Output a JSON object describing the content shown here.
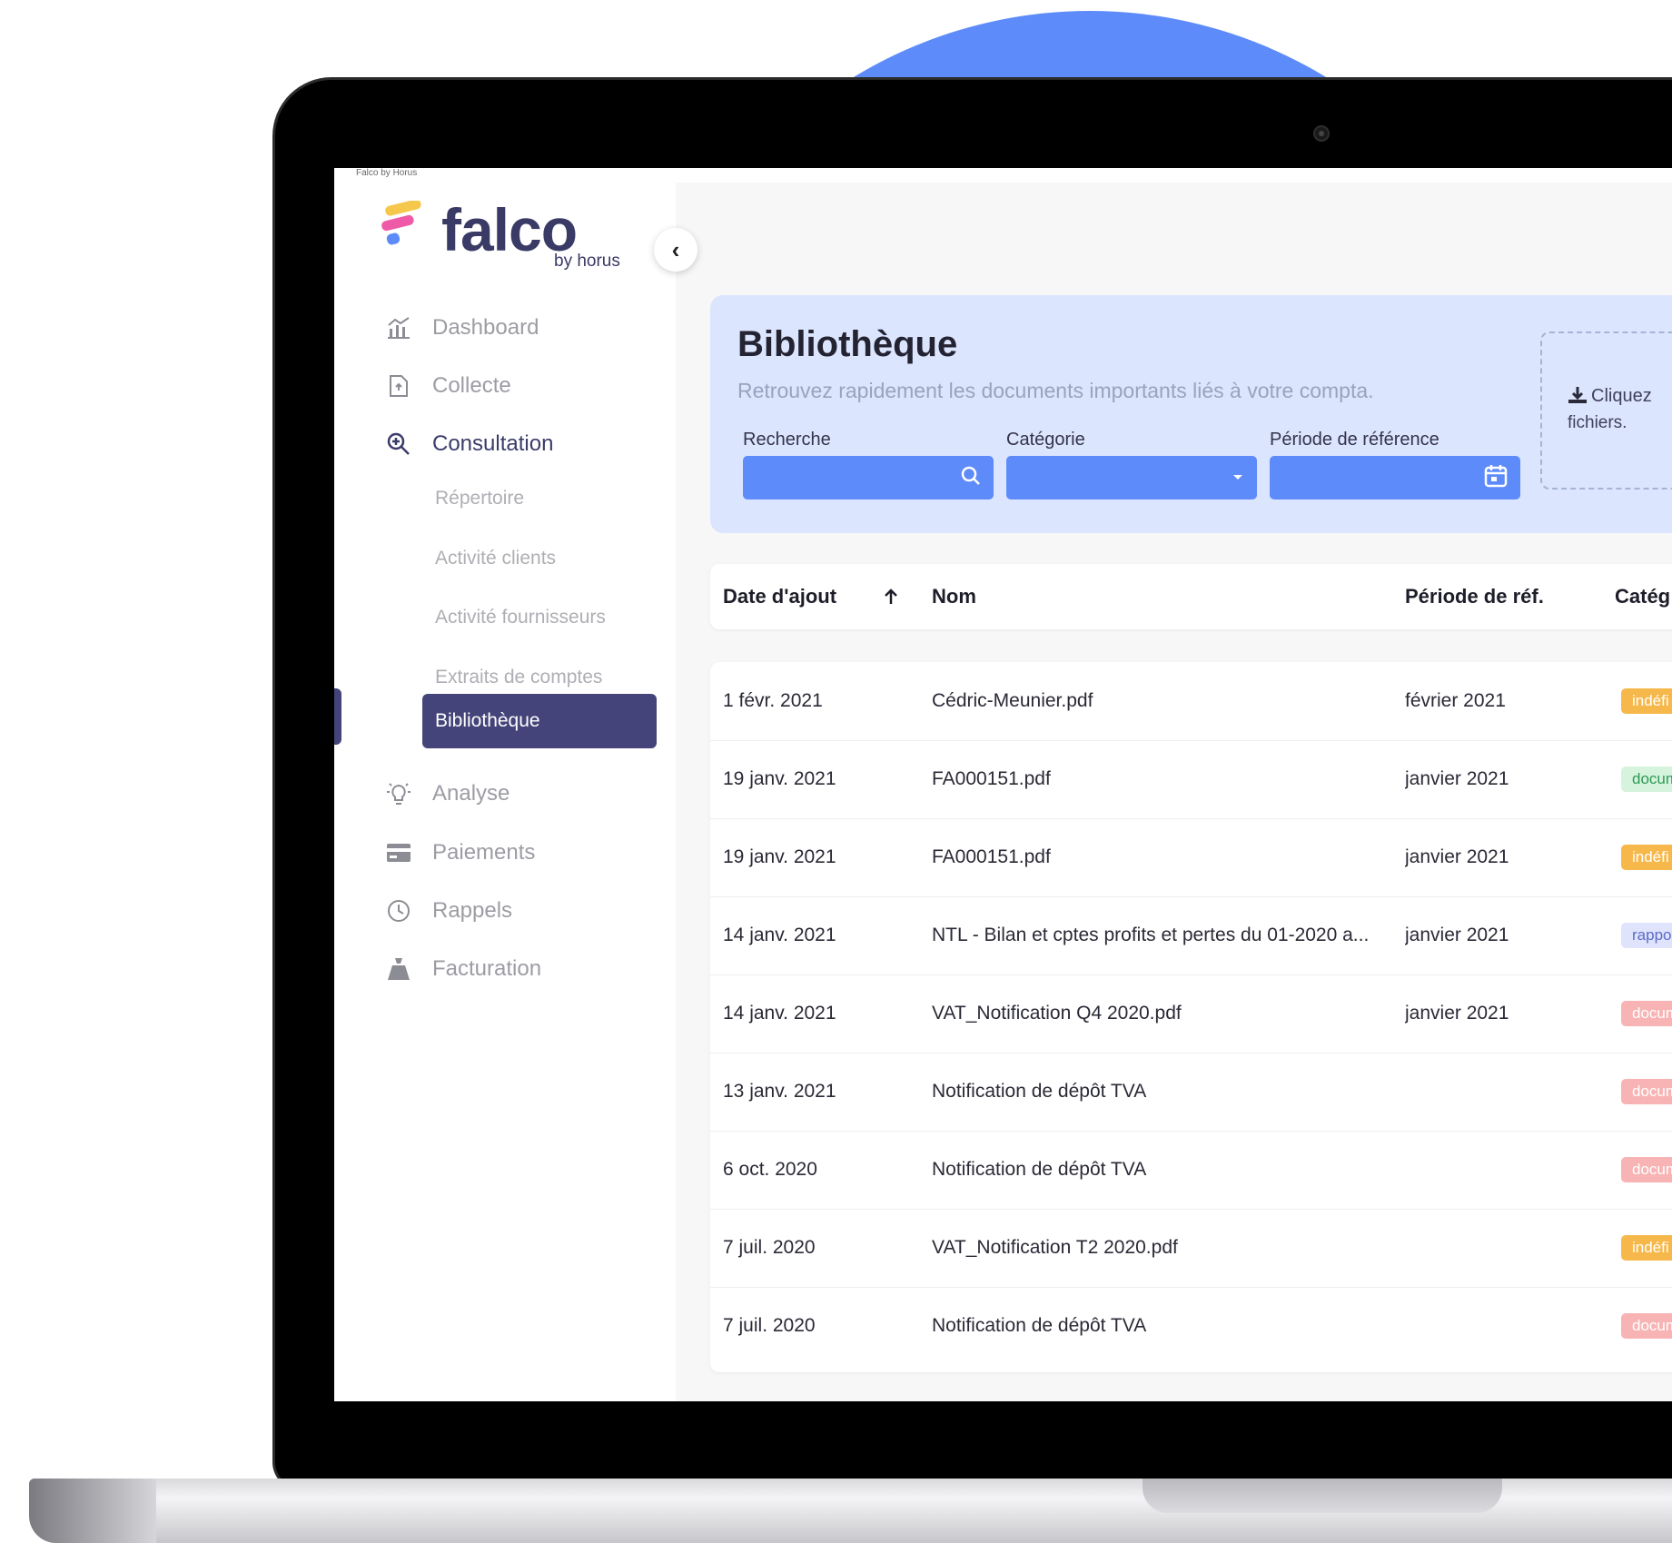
{
  "browser": {
    "tab_title": "Falco by Horus"
  },
  "logo": {
    "name": "falco",
    "tagline": "by horus"
  },
  "sidebar": {
    "collapse_icon": "chevron-left-icon",
    "items": [
      {
        "label": "Dashboard",
        "icon": "chart-icon"
      },
      {
        "label": "Collecte",
        "icon": "file-upload-icon"
      },
      {
        "label": "Consultation",
        "icon": "zoom-in-icon"
      },
      {
        "label": "Analyse",
        "icon": "lightbulb-icon"
      },
      {
        "label": "Paiements",
        "icon": "credit-card-icon"
      },
      {
        "label": "Rappels",
        "icon": "clock-icon"
      },
      {
        "label": "Facturation",
        "icon": "money-bag-icon"
      }
    ],
    "sub_items": [
      "Répertoire",
      "Activité clients",
      "Activité fournisseurs",
      "Extraits de comptes",
      "Bibliothèque"
    ]
  },
  "header": {
    "title": "Bibliothèque",
    "subtitle": "Retrouvez rapidement les documents importants liés à votre compta.",
    "filters": {
      "search_label": "Recherche",
      "category_label": "Catégorie",
      "period_label": "Période de référence"
    },
    "upload": {
      "line1": "Cliquez",
      "line2": "fichiers."
    }
  },
  "table": {
    "columns": [
      "Date d'ajout",
      "Nom",
      "Période de réf.",
      "Catég"
    ],
    "rows": [
      {
        "date": "1 févr. 2021",
        "name": "Cédric-Meunier.pdf",
        "period": "février 2021",
        "category": "indéfi"
      },
      {
        "date": "19 janv. 2021",
        "name": "FA000151.pdf",
        "period": "janvier 2021",
        "category": "docum"
      },
      {
        "date": "19 janv. 2021",
        "name": "FA000151.pdf",
        "period": "janvier 2021",
        "category": "indéfi"
      },
      {
        "date": "14 janv. 2021",
        "name": "NTL - Bilan et cptes profits et pertes du 01-2020 a...",
        "period": "janvier 2021",
        "category": "rappo"
      },
      {
        "date": "14 janv. 2021",
        "name": "VAT_Notification Q4 2020.pdf",
        "period": "janvier 2021",
        "category": "docum"
      },
      {
        "date": "13 janv. 2021",
        "name": "Notification de dépôt TVA",
        "period": "",
        "category": "docum"
      },
      {
        "date": "6 oct. 2020",
        "name": "Notification de dépôt TVA",
        "period": "",
        "category": "docum"
      },
      {
        "date": "7 juil. 2020",
        "name": "VAT_Notification T2 2020.pdf",
        "period": "",
        "category": "indéfi"
      },
      {
        "date": "7 juil. 2020",
        "name": "Notification de dépôt TVA",
        "period": "",
        "category": "docum"
      }
    ]
  },
  "colors": {
    "accent_blue": "#5e8bfa",
    "nav_active": "#44447a",
    "header_bg": "#dce5fe",
    "badge_orange": "#f7b84b",
    "badge_green": "#d5f3dd",
    "badge_purple": "#dfe3fb",
    "badge_red": "#f8b4b4"
  }
}
